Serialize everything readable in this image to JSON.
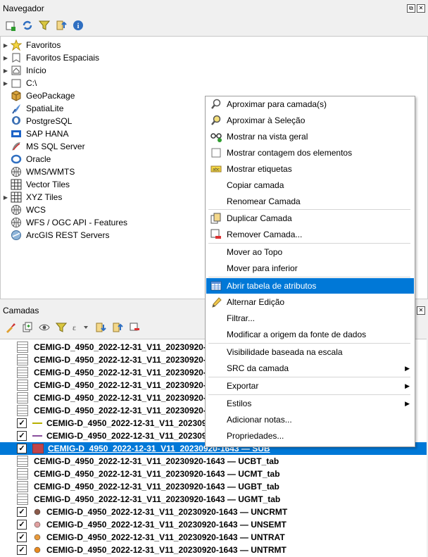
{
  "navigator": {
    "title": "Navegador",
    "items": [
      {
        "label": "Favoritos",
        "icon": "star-icon",
        "expand": true
      },
      {
        "label": "Favoritos Espaciais",
        "icon": "spatial-bookmark-icon",
        "expand": true
      },
      {
        "label": "Início",
        "icon": "home-icon",
        "expand": true
      },
      {
        "label": "C:\\",
        "icon": "folder-icon",
        "expand": true
      },
      {
        "label": "GeoPackage",
        "icon": "geopackage-icon",
        "expand": false
      },
      {
        "label": "SpatiaLite",
        "icon": "spatialite-icon",
        "expand": false
      },
      {
        "label": "PostgreSQL",
        "icon": "postgresql-icon",
        "expand": false
      },
      {
        "label": "SAP HANA",
        "icon": "sap-hana-icon",
        "expand": false
      },
      {
        "label": "MS SQL Server",
        "icon": "mssql-icon",
        "expand": false
      },
      {
        "label": "Oracle",
        "icon": "oracle-icon",
        "expand": false
      },
      {
        "label": "WMS/WMTS",
        "icon": "wms-icon",
        "expand": false
      },
      {
        "label": "Vector Tiles",
        "icon": "vector-tiles-icon",
        "expand": false
      },
      {
        "label": "XYZ Tiles",
        "icon": "xyz-tiles-icon",
        "expand": true
      },
      {
        "label": "WCS",
        "icon": "wcs-icon",
        "expand": false
      },
      {
        "label": "WFS / OGC API - Features",
        "icon": "wfs-icon",
        "expand": false
      },
      {
        "label": "ArcGIS REST Servers",
        "icon": "arcgis-icon",
        "expand": false
      }
    ]
  },
  "layers": {
    "title": "Camadas",
    "rows": [
      {
        "label": "CEMIG-D_4950_2022-12-31_V11_20230920-",
        "kind": "table",
        "checked": false,
        "sym": ""
      },
      {
        "label": "CEMIG-D_4950_2022-12-31_V11_20230920-",
        "kind": "table",
        "checked": false,
        "sym": ""
      },
      {
        "label": "CEMIG-D_4950_2022-12-31_V11_20230920-",
        "kind": "table",
        "checked": false,
        "sym": ""
      },
      {
        "label": "CEMIG-D_4950_2022-12-31_V11_20230920-",
        "kind": "table",
        "checked": false,
        "sym": ""
      },
      {
        "label": "CEMIG-D_4950_2022-12-31_V11_20230920-",
        "kind": "table",
        "checked": false,
        "sym": ""
      },
      {
        "label": "CEMIG-D_4950_2022-12-31_V11_20230920-",
        "kind": "table",
        "checked": false,
        "sym": ""
      },
      {
        "label": "CEMIG-D_4950_2022-12-31_V11_20230920",
        "kind": "layer",
        "checked": true,
        "sym": "line",
        "color": "#b7b000"
      },
      {
        "label": "CEMIG-D_4950_2022-12-31_V11_20230920",
        "kind": "layer",
        "checked": true,
        "sym": "line",
        "color": "#8a4f9e"
      },
      {
        "label": "CEMIG-D_4950_2022-12-31_V11_20230920-1643 — SUB",
        "kind": "layer",
        "checked": true,
        "sym": "square",
        "color": "#c0444a",
        "selected": true
      },
      {
        "label": "CEMIG-D_4950_2022-12-31_V11_20230920-1643 — UCBT_tab",
        "kind": "table",
        "checked": false,
        "sym": ""
      },
      {
        "label": "CEMIG-D_4950_2022-12-31_V11_20230920-1643 — UCMT_tab",
        "kind": "table",
        "checked": false,
        "sym": ""
      },
      {
        "label": "CEMIG-D_4950_2022-12-31_V11_20230920-1643 — UGBT_tab",
        "kind": "table",
        "checked": false,
        "sym": ""
      },
      {
        "label": "CEMIG-D_4950_2022-12-31_V11_20230920-1643 — UGMT_tab",
        "kind": "table",
        "checked": false,
        "sym": ""
      },
      {
        "label": "CEMIG-D_4950_2022-12-31_V11_20230920-1643 — UNCRMT",
        "kind": "layer",
        "checked": true,
        "sym": "dot",
        "color": "#8b5a4a"
      },
      {
        "label": "CEMIG-D_4950_2022-12-31_V11_20230920-1643 — UNSEMT",
        "kind": "layer",
        "checked": true,
        "sym": "dot",
        "color": "#e0a0a0"
      },
      {
        "label": "CEMIG-D_4950_2022-12-31_V11_20230920-1643 — UNTRAT",
        "kind": "layer",
        "checked": true,
        "sym": "dot",
        "color": "#e89a3c"
      },
      {
        "label": "CEMIG-D_4950_2022-12-31_V11_20230920-1643 — UNTRMT",
        "kind": "layer",
        "checked": true,
        "sym": "dot",
        "color": "#e88a20"
      }
    ]
  },
  "context_menu": {
    "items": [
      {
        "label": "Aproximar para camada(s)",
        "icon": "zoom-to-layer-icon"
      },
      {
        "label": "Aproximar à Seleção",
        "icon": "zoom-to-selection-icon"
      },
      {
        "label": "Mostrar na vista geral",
        "icon": "overview-icon"
      },
      {
        "label": "Mostrar contagem dos elementos",
        "icon": "checkbox-icon"
      },
      {
        "label": "Mostrar etiquetas",
        "icon": "labels-icon"
      },
      {
        "label": "Copiar camada",
        "icon": ""
      },
      {
        "label": "Renomear Camada",
        "icon": ""
      },
      {
        "label": "Duplicar Camada",
        "icon": "duplicate-icon"
      },
      {
        "label": "Remover Camada...",
        "icon": "remove-layer-icon"
      },
      {
        "label": "Mover ao Topo",
        "icon": ""
      },
      {
        "label": "Mover para  inferior",
        "icon": ""
      },
      {
        "label": "Abrir tabela de atributos",
        "icon": "attribute-table-icon"
      },
      {
        "label": "Alternar Edição",
        "icon": "pencil-icon"
      },
      {
        "label": "Filtrar...",
        "icon": ""
      },
      {
        "label": "Modificar a origem da fonte de dados",
        "icon": ""
      },
      {
        "label": "Visibilidade baseada na escala",
        "icon": ""
      },
      {
        "label": "SRC da camada",
        "icon": ""
      },
      {
        "label": "Exportar",
        "icon": ""
      },
      {
        "label": "Estilos",
        "icon": ""
      },
      {
        "label": "Adicionar notas...",
        "icon": ""
      },
      {
        "label": "Propriedades...",
        "icon": ""
      }
    ]
  },
  "colors": {
    "accent": "#0078d7",
    "selection_text": "#ffffff"
  }
}
